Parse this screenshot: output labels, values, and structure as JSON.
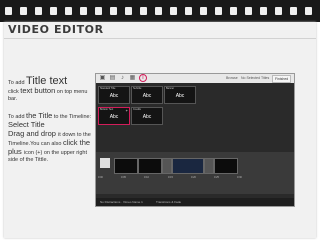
{
  "slide": {
    "title": "VIDEO EDITOR",
    "instructions": {
      "p1_a": "To add ",
      "p1_b": "Title text",
      "p1_c": "click ",
      "p1_d": "text button",
      "p1_e": " on top menu bar.",
      "p2_a": "To add ",
      "p2_b": "the Title",
      "p2_c": " to the Timeline:",
      "p2_d": "Select Title",
      "p2_e": "Drag and drop ",
      "p2_f": "it down to the Timeline.You can also ",
      "p2_g": "click the plus ",
      "p2_h": "icon (+) on the upper right side of the Tittle."
    }
  },
  "app": {
    "toolbar": {
      "right_label_1": "Browse",
      "right_label_2": "No Selected Titles",
      "right_button": "Finished"
    },
    "tiles": [
      {
        "caption": "Standard Title",
        "text": "Abc"
      },
      {
        "caption": "Subtitle",
        "text": "Abc"
      },
      {
        "caption": "Banner",
        "text": "Abc"
      },
      {
        "caption": "Bottom Text",
        "text": "Abc"
      },
      {
        "caption": "Credits",
        "text": "Abc"
      }
    ],
    "timeline": {
      "ticks": [
        "0:00",
        "0:05",
        "0:10",
        "0:15",
        "0:20",
        "0:25",
        "0:30"
      ]
    },
    "status": {
      "left": "No Distractions · Vimeo Name 1",
      "middle": "Transitions & Fade"
    }
  }
}
